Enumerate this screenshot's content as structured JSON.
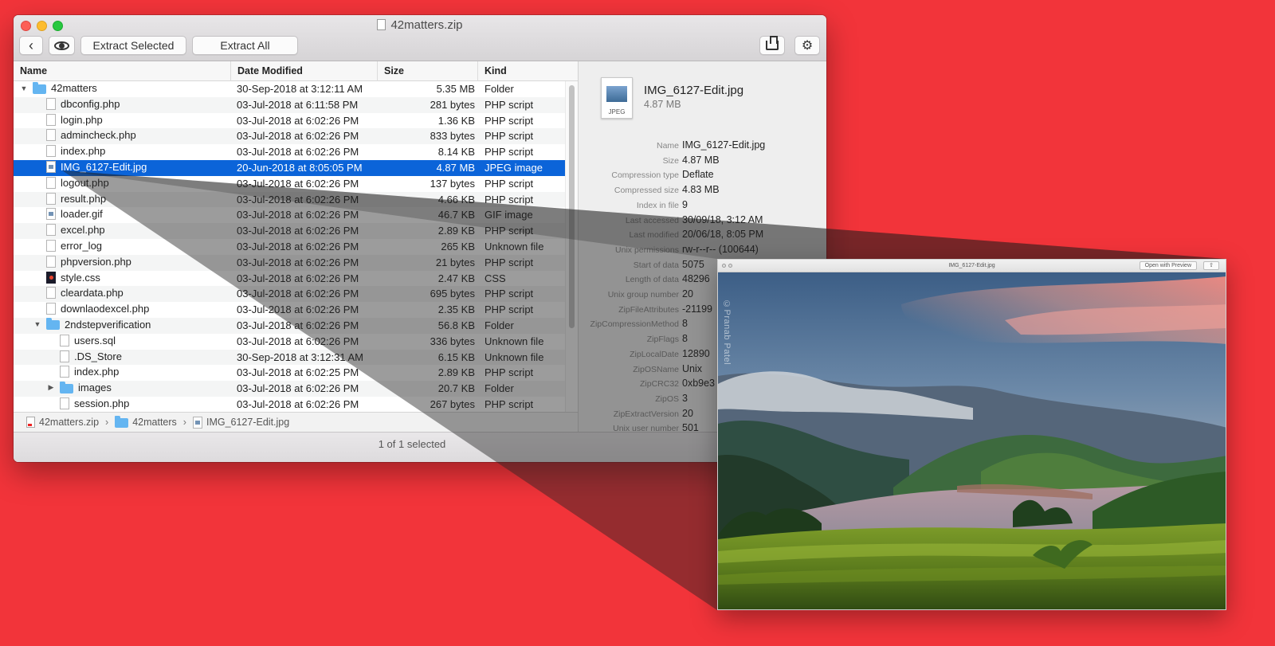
{
  "window": {
    "title": "42matters.zip"
  },
  "toolbar": {
    "back_label": "‹",
    "extract_selected": "Extract Selected",
    "extract_all": "Extract All",
    "gear_label": "⚙"
  },
  "columns": {
    "name": "Name",
    "date": "Date Modified",
    "size": "Size",
    "kind": "Kind"
  },
  "files": [
    {
      "name": "42matters",
      "date": "30-Sep-2018 at 3:12:11 AM",
      "size": "5.35 MB",
      "kind": "Folder"
    },
    {
      "name": "dbconfig.php",
      "date": "03-Jul-2018 at 6:11:58 PM",
      "size": "281 bytes",
      "kind": "PHP script"
    },
    {
      "name": "login.php",
      "date": "03-Jul-2018 at 6:02:26 PM",
      "size": "1.36 KB",
      "kind": "PHP script"
    },
    {
      "name": "admincheck.php",
      "date": "03-Jul-2018 at 6:02:26 PM",
      "size": "833 bytes",
      "kind": "PHP script"
    },
    {
      "name": "index.php",
      "date": "03-Jul-2018 at 6:02:26 PM",
      "size": "8.14 KB",
      "kind": "PHP script"
    },
    {
      "name": "IMG_6127-Edit.jpg",
      "date": "20-Jun-2018 at 8:05:05 PM",
      "size": "4.87 MB",
      "kind": "JPEG image"
    },
    {
      "name": "logout.php",
      "date": "03-Jul-2018 at 6:02:26 PM",
      "size": "137 bytes",
      "kind": "PHP script"
    },
    {
      "name": "result.php",
      "date": "03-Jul-2018 at 6:02:26 PM",
      "size": "4.66 KB",
      "kind": "PHP script"
    },
    {
      "name": "loader.gif",
      "date": "03-Jul-2018 at 6:02:26 PM",
      "size": "46.7 KB",
      "kind": "GIF image"
    },
    {
      "name": "excel.php",
      "date": "03-Jul-2018 at 6:02:26 PM",
      "size": "2.89 KB",
      "kind": "PHP script"
    },
    {
      "name": "error_log",
      "date": "03-Jul-2018 at 6:02:26 PM",
      "size": "265 KB",
      "kind": "Unknown file"
    },
    {
      "name": "phpversion.php",
      "date": "03-Jul-2018 at 6:02:26 PM",
      "size": "21 bytes",
      "kind": "PHP script"
    },
    {
      "name": "style.css",
      "date": "03-Jul-2018 at 6:02:26 PM",
      "size": "2.47 KB",
      "kind": "CSS"
    },
    {
      "name": "cleardata.php",
      "date": "03-Jul-2018 at 6:02:26 PM",
      "size": "695 bytes",
      "kind": "PHP script"
    },
    {
      "name": "downlaodexcel.php",
      "date": "03-Jul-2018 at 6:02:26 PM",
      "size": "2.35 KB",
      "kind": "PHP script"
    },
    {
      "name": "2ndstepverification",
      "date": "03-Jul-2018 at 6:02:26 PM",
      "size": "56.8 KB",
      "kind": "Folder"
    },
    {
      "name": "users.sql",
      "date": "03-Jul-2018 at 6:02:26 PM",
      "size": "336 bytes",
      "kind": "Unknown file"
    },
    {
      "name": ".DS_Store",
      "date": "30-Sep-2018 at 3:12:31 AM",
      "size": "6.15 KB",
      "kind": "Unknown file"
    },
    {
      "name": "index.php",
      "date": "03-Jul-2018 at 6:02:25 PM",
      "size": "2.89 KB",
      "kind": "PHP script"
    },
    {
      "name": "images",
      "date": "03-Jul-2018 at 6:02:26 PM",
      "size": "20.7 KB",
      "kind": "Folder"
    },
    {
      "name": "session.php",
      "date": "03-Jul-2018 at 6:02:26 PM",
      "size": "267 bytes",
      "kind": "PHP script"
    }
  ],
  "pathbar": {
    "archive": "42matters.zip",
    "folder": "42matters",
    "file": "IMG_6127-Edit.jpg",
    "separator": "›"
  },
  "status": {
    "text": "1 of 1 selected"
  },
  "info": {
    "icon_label": "JPEG",
    "file_name": "IMG_6127-Edit.jpg",
    "file_size": "4.87 MB",
    "properties": [
      {
        "key": "Name",
        "value": "IMG_6127-Edit.jpg"
      },
      {
        "key": "Size",
        "value": "4.87 MB"
      },
      {
        "key": "Compression type",
        "value": "Deflate"
      },
      {
        "key": "Compressed size",
        "value": "4.83 MB"
      },
      {
        "key": "Index in file",
        "value": "9"
      },
      {
        "key": "Last accessed",
        "value": "30/09/18, 3:12 AM"
      },
      {
        "key": "Last modified",
        "value": "20/06/18, 8:05 PM"
      },
      {
        "key": "Unix permissions",
        "value": "rw-r--r-- (100644)"
      },
      {
        "key": "Start of data",
        "value": "5075"
      },
      {
        "key": "Length of data",
        "value": "48296"
      },
      {
        "key": "Unix group number",
        "value": "20"
      },
      {
        "key": "ZipFileAttributes",
        "value": "-21199"
      },
      {
        "key": "ZipCompressionMethod",
        "value": "8"
      },
      {
        "key": "ZipFlags",
        "value": "8"
      },
      {
        "key": "ZipLocalDate",
        "value": "12890"
      },
      {
        "key": "ZipOSName",
        "value": "Unix"
      },
      {
        "key": "ZipCRC32",
        "value": "0xb9e3"
      },
      {
        "key": "ZipOS",
        "value": "3"
      },
      {
        "key": "ZipExtractVersion",
        "value": "20"
      },
      {
        "key": "Unix user number",
        "value": "501"
      }
    ]
  },
  "preview": {
    "title": "IMG_6127-Edit.jpg",
    "open_button": "Open with Preview",
    "share_label": "⇧",
    "watermark": "©Pranab Patel"
  },
  "colors": {
    "background": "#f2343a",
    "selection": "#0b64d9",
    "folder": "#64b5f1"
  }
}
